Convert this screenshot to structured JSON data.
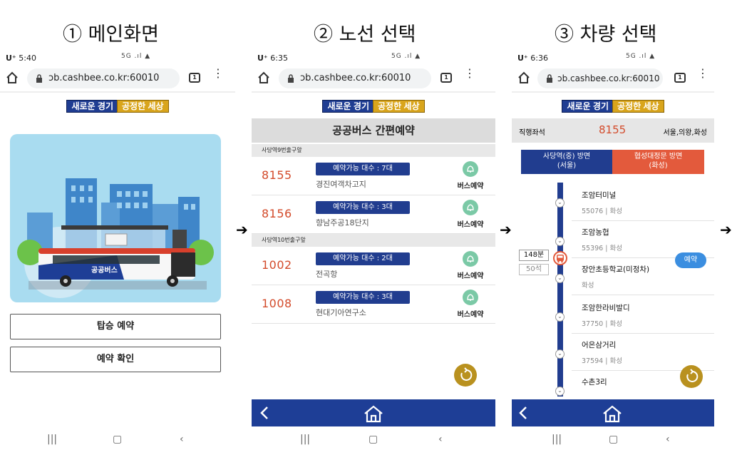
{
  "titles": {
    "step1": "① 메인화면",
    "step2": "② 노선 선택",
    "step3": "③ 차량 선택"
  },
  "arrow_glyph": "➔",
  "browser": {
    "url": "ɔb.cashbee.co.kr:60010",
    "tab_count": "1"
  },
  "status": {
    "carrier": "U⁺",
    "time1": "5:40",
    "time2": "6:35",
    "time3": "6:36",
    "signal": "5G .ıl ▲"
  },
  "banner": {
    "left": "새로운 경기",
    "right": "공정한 세상"
  },
  "screen1": {
    "hero_bus_label": "공공버스",
    "board_button": "탑승 예약",
    "confirm_button": "예약 확인"
  },
  "screen2": {
    "header": "공공버스 간편예약",
    "groups": [
      {
        "label": "사당역9번출구앞",
        "routes": [
          {
            "number": "8155",
            "availability": "예약가능 대수 : 7대",
            "dest": "경진여객차고지",
            "action": "버스예약"
          },
          {
            "number": "8156",
            "availability": "예약가능 대수 : 3대",
            "dest": "향남주공18단지",
            "action": "버스예약"
          }
        ]
      },
      {
        "label": "사당역10번출구앞",
        "routes": [
          {
            "number": "1002",
            "availability": "예약가능 대수 : 2대",
            "dest": "전곡항",
            "action": "버스예약"
          },
          {
            "number": "1008",
            "availability": "예약가능 대수 : 3대",
            "dest": "현대기아연구소",
            "action": "버스예약"
          }
        ]
      }
    ]
  },
  "screen3": {
    "seat_type": "직행좌석",
    "route_number": "8155",
    "route_area": "서울,의왕,화성",
    "tab_left": "사당역(중) 방면",
    "tab_left_sub": "(서울)",
    "tab_right": "협성대정문 방면",
    "tab_right_sub": "(화성)",
    "bus_time": "148분",
    "bus_seats": "50석",
    "reserve_button": "예약",
    "stops": [
      {
        "name": "조암터미널",
        "sub": "55076 | 화성"
      },
      {
        "name": "조암농협",
        "sub": "55396 | 화성"
      },
      {
        "name": "장안초등학교(미정차)",
        "sub": "화성"
      },
      {
        "name": "조암한라비발디",
        "sub": "37750 | 화성"
      },
      {
        "name": "어은삼거리",
        "sub": "37594 | 화성"
      },
      {
        "name": "수촌3리",
        "sub": ""
      }
    ]
  },
  "colors": {
    "navy": "#1e3e96",
    "route_red": "#d34b2b",
    "gold": "#b9911f",
    "bell_green": "#7bc9a6",
    "orange_tab": "#e35a3c"
  }
}
